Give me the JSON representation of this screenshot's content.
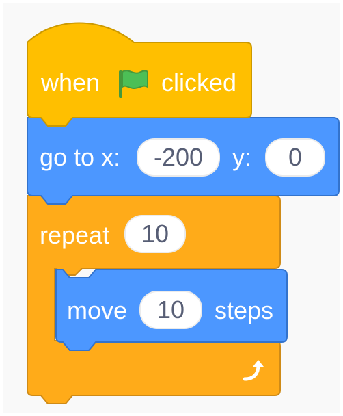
{
  "colors": {
    "events": "#FFBF00",
    "events_border": "#CC9900",
    "motion": "#4C97FF",
    "motion_border": "#3373CC",
    "control": "#FFAB19",
    "control_border": "#CF8B17",
    "flag_green": "#4CBF56"
  },
  "hat_block": {
    "word_when": "when",
    "icon": "green-flag-icon",
    "word_clicked": "clicked"
  },
  "goto_block": {
    "label_x": "go to x:",
    "x_value": "-200",
    "label_y": "y:",
    "y_value": "0"
  },
  "repeat_block": {
    "label": "repeat",
    "count": "10",
    "loop_icon": "rotate-arrow-icon"
  },
  "move_block": {
    "label_move": "move",
    "steps_value": "10",
    "label_steps": "steps"
  }
}
